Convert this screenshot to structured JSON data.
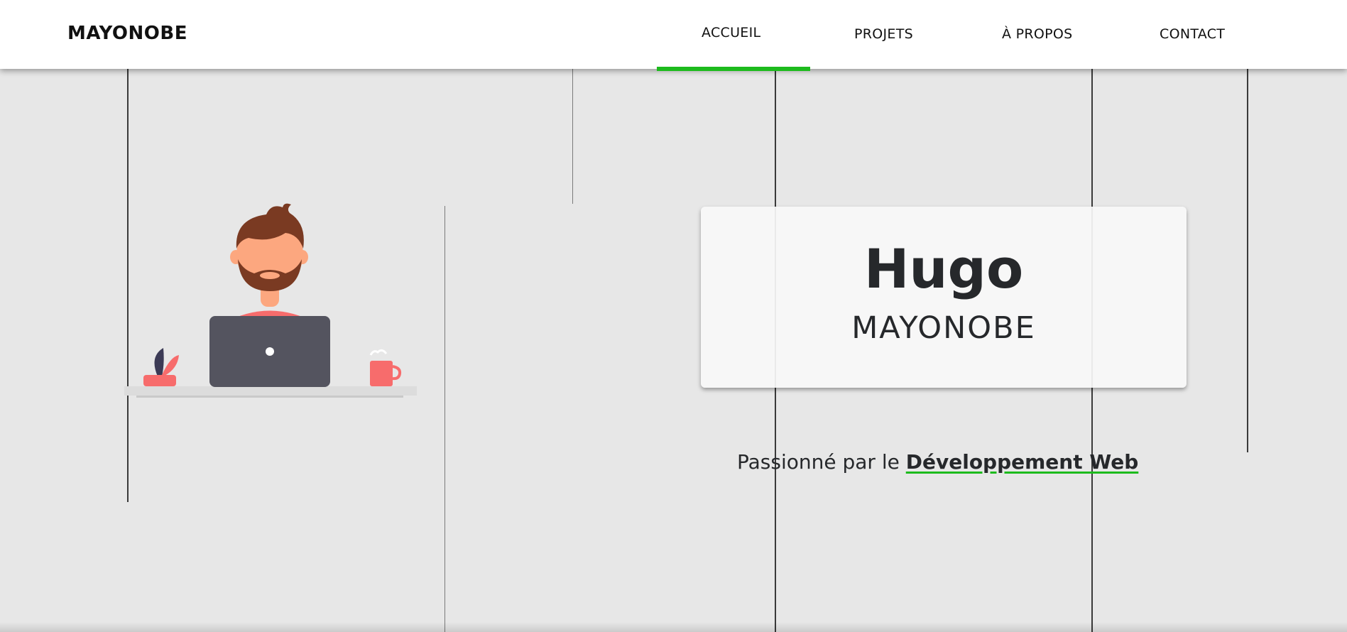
{
  "header": {
    "logo": "MAYONOBE",
    "nav": [
      {
        "label": "ACCUEIL",
        "active": true
      },
      {
        "label": "PROJETS",
        "active": false
      },
      {
        "label": "À PROPOS",
        "active": false
      },
      {
        "label": "CONTACT",
        "active": false
      }
    ]
  },
  "hero": {
    "first_name": "Hugo",
    "last_name": "MAYONOBE",
    "tagline_prefix": "Passionné par le ",
    "tagline_highlight": "Développement Web"
  },
  "colors": {
    "accent": "#1dbb1d",
    "background": "#e7e7e7",
    "text": "#26282b"
  },
  "icons": {
    "illustration": "developer-at-laptop-illustration"
  }
}
